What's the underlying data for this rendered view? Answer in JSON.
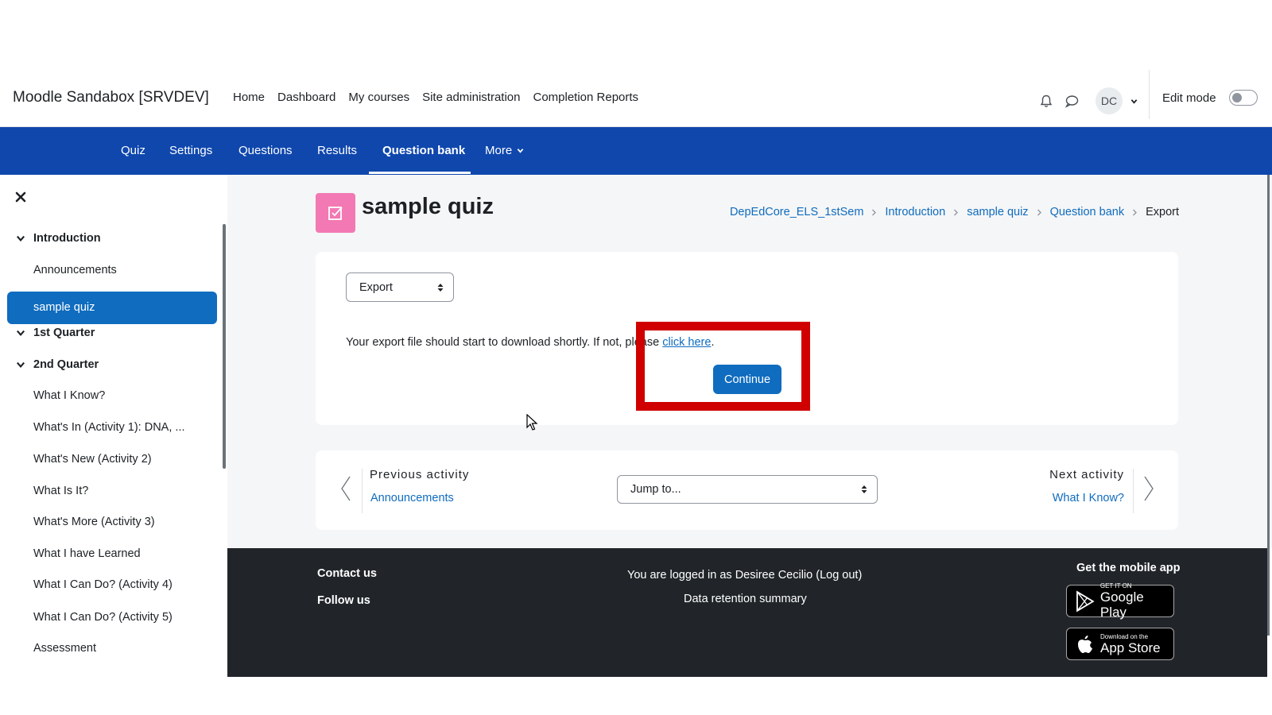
{
  "site": {
    "brand": "Moodle Sandabox [SRVDEV]"
  },
  "primary_nav": [
    "Home",
    "Dashboard",
    "My courses",
    "Site administration",
    "Completion Reports"
  ],
  "user": {
    "initials": "DC"
  },
  "edit_mode": {
    "label": "Edit mode"
  },
  "secondary_nav": {
    "items": [
      "Quiz",
      "Settings",
      "Questions",
      "Results",
      "Question bank",
      "More"
    ],
    "active": "Question bank"
  },
  "drawer": {
    "sections": [
      "Introduction",
      "1st Quarter",
      "2nd Quarter"
    ],
    "intro_items": [
      "Announcements",
      "sample quiz"
    ],
    "active_item": "sample quiz",
    "q2_items": [
      "What I Know?",
      "What's In (Activity 1): DNA, ...",
      "What's New (Activity 2)",
      "What Is It?",
      "What's More (Activity 3)",
      "What I have Learned",
      "What I Can Do? (Activity 4)",
      "What I Can Do? (Activity 5)",
      "Assessment"
    ]
  },
  "page": {
    "title": "sample quiz",
    "breadcrumb": [
      "DepEdCore_ELS_1stSem",
      "Introduction",
      "sample quiz",
      "Question bank",
      "Export"
    ]
  },
  "export": {
    "select_value": "Export",
    "message_prefix": "Your export file should start to download shortly. If not, please ",
    "link_text": "click here",
    "message_suffix": ".",
    "continue_label": "Continue"
  },
  "activity_nav": {
    "prev_label": "Previous activity",
    "prev_link": "Announcements",
    "jump_placeholder": "Jump to...",
    "next_label": "Next activity",
    "next_link": "What I Know?"
  },
  "footer": {
    "contact": "Contact us",
    "follow": "Follow us",
    "logged_in": "You are logged in as Desiree Cecilio (Log out)",
    "data_retention": "Data retention summary",
    "mobile_app": "Get the mobile app",
    "google_small": "GET IT ON",
    "google_big": "Google Play",
    "apple_small": "Download on the",
    "apple_big": "App Store"
  },
  "colors": {
    "primary": "#0f6cbf",
    "secnav_bg": "#0f47ad",
    "highlight": "#d00000",
    "quiz_icon": "#f279b3",
    "footer_bg": "#212529"
  }
}
